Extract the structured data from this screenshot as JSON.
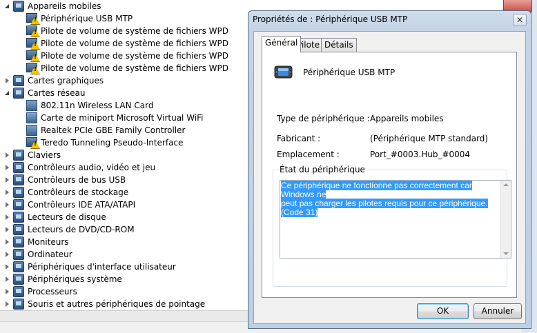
{
  "tree": {
    "items": [
      {
        "label": "Appareils mobiles",
        "level": 0,
        "arrow": "open",
        "icon": "mobile-devices-icon"
      },
      {
        "label": "Périphérique USB MTP",
        "level": 1,
        "icon": "warning-device-icon"
      },
      {
        "label": "Pilote de volume de système de fichiers WPD",
        "level": 1,
        "icon": "warning-device-icon"
      },
      {
        "label": "Pilote de volume de système de fichiers WPD",
        "level": 1,
        "icon": "warning-device-icon"
      },
      {
        "label": "Pilote de volume de système de fichiers WPD",
        "level": 1,
        "icon": "warning-device-icon"
      },
      {
        "label": "Pilote de volume de système de fichiers WPD",
        "level": 1,
        "icon": "warning-device-icon"
      },
      {
        "label": "Cartes graphiques",
        "level": 0,
        "arrow": "closed",
        "icon": "display-adapter-icon"
      },
      {
        "label": "Cartes réseau",
        "level": 0,
        "arrow": "open",
        "icon": "network-adapter-icon"
      },
      {
        "label": "802.11n Wireless LAN Card",
        "level": 1,
        "icon": "network-card-icon"
      },
      {
        "label": "Carte de miniport Microsoft Virtual WiFi",
        "level": 1,
        "icon": "network-card-icon"
      },
      {
        "label": "Realtek PCIe GBE Family Controller",
        "level": 1,
        "icon": "network-card-icon"
      },
      {
        "label": "Teredo Tunneling Pseudo-Interface",
        "level": 1,
        "icon": "warning-device-icon"
      },
      {
        "label": "Claviers",
        "level": 0,
        "arrow": "closed",
        "icon": "keyboard-icon"
      },
      {
        "label": "Contrôleurs audio, vidéo et jeu",
        "level": 0,
        "arrow": "closed",
        "icon": "audio-icon"
      },
      {
        "label": "Contrôleurs de bus USB",
        "level": 0,
        "arrow": "closed",
        "icon": "usb-icon"
      },
      {
        "label": "Contrôleurs de stockage",
        "level": 0,
        "arrow": "closed",
        "icon": "storage-controller-icon"
      },
      {
        "label": "Contrôleurs IDE ATA/ATAPI",
        "level": 0,
        "arrow": "closed",
        "icon": "ide-controller-icon"
      },
      {
        "label": "Lecteurs de disque",
        "level": 0,
        "arrow": "closed",
        "icon": "disk-drive-icon"
      },
      {
        "label": "Lecteurs de DVD/CD-ROM",
        "level": 0,
        "arrow": "closed",
        "icon": "dvd-drive-icon"
      },
      {
        "label": "Moniteurs",
        "level": 0,
        "arrow": "closed",
        "icon": "monitor-icon"
      },
      {
        "label": "Ordinateur",
        "level": 0,
        "arrow": "closed",
        "icon": "computer-icon"
      },
      {
        "label": "Périphériques d'interface utilisateur",
        "level": 0,
        "arrow": "closed",
        "icon": "hid-icon"
      },
      {
        "label": "Périphériques système",
        "level": 0,
        "arrow": "closed",
        "icon": "system-devices-icon"
      },
      {
        "label": "Processeurs",
        "level": 0,
        "arrow": "closed",
        "icon": "processor-icon"
      },
      {
        "label": "Souris et autres périphériques de pointage",
        "level": 0,
        "arrow": "closed",
        "icon": "mouse-icon"
      }
    ]
  },
  "dialog": {
    "title": "Propriétés de : Périphérique USB MTP",
    "close_glyph": "✕",
    "tabs": [
      {
        "label": "Général",
        "active": true
      },
      {
        "label": "Pilote",
        "active": false
      },
      {
        "label": "Détails",
        "active": false
      }
    ],
    "device_name": "Périphérique USB MTP",
    "device_icon": "portable-device-icon",
    "fields": {
      "type_label": "Type de périphérique :",
      "type_value": "Appareils mobiles",
      "maker_label": "Fabricant :",
      "maker_value": "(Périphérique MTP standard)",
      "location_label": "Emplacement :",
      "location_value": "Port_#0003.Hub_#0004"
    },
    "status_title": "État du périphérique",
    "status_text_line1": "Ce périphérique ne fonctionne pas correctement car Windows ne",
    "status_text_line2": "peut pas charger les pilotes requis pour ce périphérique. (Code 31)",
    "ok_label": "OK",
    "cancel_label": "Annuler"
  },
  "colors": {
    "selection": "#3399ff",
    "dialog_frame": "#c4d4e6",
    "warning": "#f5c400"
  }
}
